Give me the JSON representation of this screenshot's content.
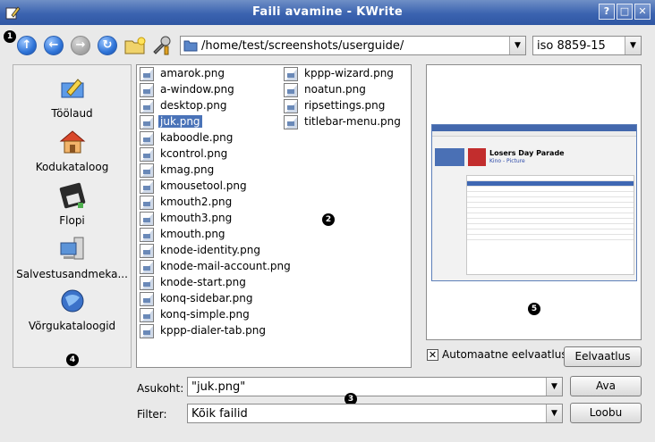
{
  "window": {
    "title": "Faili avamine - KWrite",
    "help_label": "?",
    "maximize_label": "□",
    "close_label": "✕"
  },
  "callouts": [
    "1",
    "2",
    "3",
    "4",
    "5"
  ],
  "toolbar": {
    "back_label": "↑",
    "prev_label": "←",
    "next_label": "→",
    "reload_label": "↻",
    "path": "/home/test/screenshots/userguide/",
    "encoding": "iso 8859-15"
  },
  "places": [
    {
      "label": "Töölaud",
      "icon": "desktop-icon"
    },
    {
      "label": "Kodukataloog",
      "icon": "home-icon"
    },
    {
      "label": "Flopi",
      "icon": "floppy-icon"
    },
    {
      "label": "Salvestusandmeka...",
      "icon": "storage-icon"
    },
    {
      "label": "Võrgukataloogid",
      "icon": "network-icon"
    }
  ],
  "files_col1": [
    "amarok.png",
    "a-window.png",
    "desktop.png",
    "juk.png",
    "kaboodle.png",
    "kcontrol.png",
    "kmag.png",
    "kmousetool.png",
    "kmouth2.png",
    "kmouth3.png",
    "kmouth.png",
    "knode-identity.png",
    "knode-mail-account.png",
    "knode-start.png",
    "konq-sidebar.png",
    "konq-simple.png",
    "kppp-dialer-tab.png"
  ],
  "files_col2": [
    "kppp-wizard.png",
    "noatun.png",
    "ripsettings.png",
    "titlebar-menu.png"
  ],
  "selected_file": "juk.png",
  "preview": {
    "thumb_title": "Losers Day Parade",
    "thumb_subtitle": "Kino - Picture",
    "autopreview_label": "Automaatne eelvaatlus",
    "autopreview_checked": true,
    "preview_button": "Eelvaatlus"
  },
  "location": {
    "label": "Asukoht:",
    "value": "\"juk.png\"",
    "button": "Ava"
  },
  "filter": {
    "label": "Filter:",
    "value": "Kõik failid",
    "button": "Loobu"
  }
}
